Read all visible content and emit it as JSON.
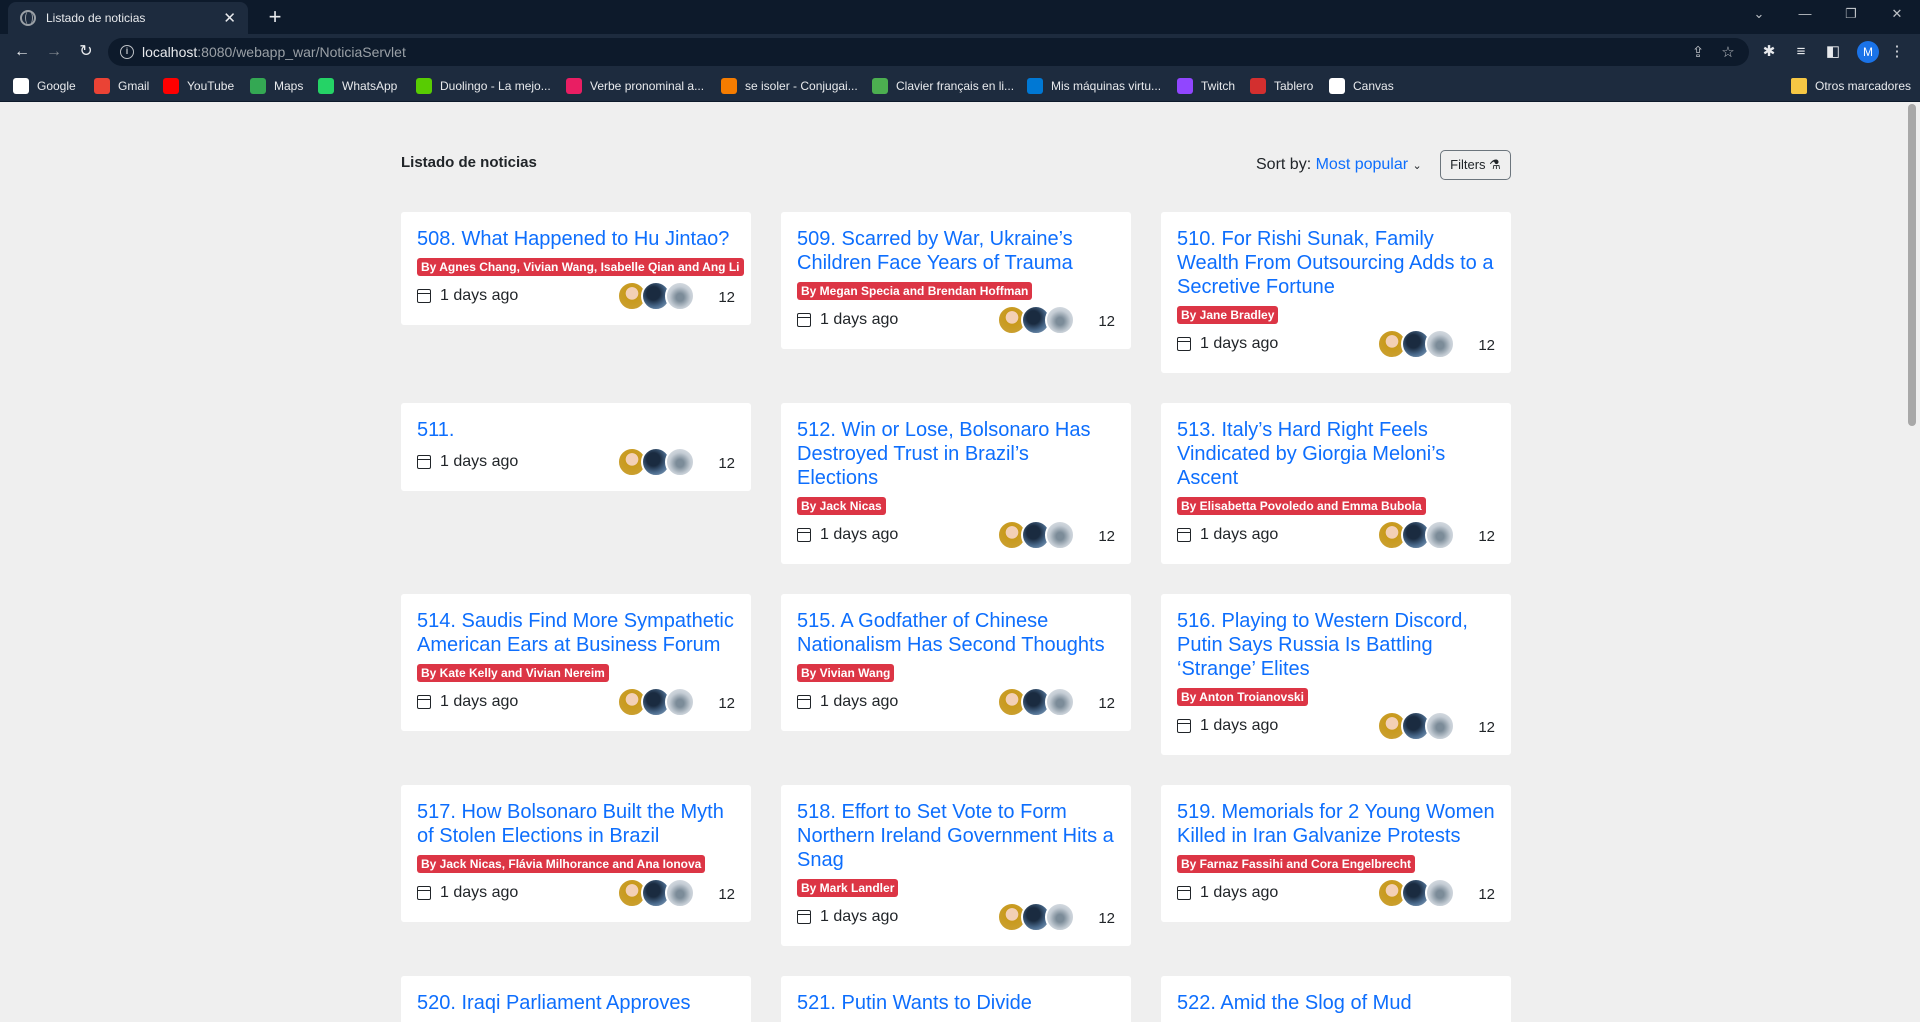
{
  "browser": {
    "tab_title": "Listado de noticias",
    "url_host": "localhost",
    "url_path": ":8080/webapp_war/NoticiaServlet",
    "profile_initial": "M"
  },
  "bookmarks": [
    {
      "label": "Google",
      "icon": "google-icon",
      "color": "#ffffff"
    },
    {
      "label": "Gmail",
      "icon": "gmail-icon",
      "color": "#ea4335"
    },
    {
      "label": "YouTube",
      "icon": "youtube-icon",
      "color": "#ff0000"
    },
    {
      "label": "Maps",
      "icon": "maps-icon",
      "color": "#34a853"
    },
    {
      "label": "WhatsApp",
      "icon": "whatsapp-icon",
      "color": "#25d366"
    },
    {
      "label": "Duolingo - La mejo...",
      "icon": "duolingo-icon",
      "color": "#58cc02"
    },
    {
      "label": "Verbe pronominal a...",
      "icon": "verbe-icon",
      "color": "#e91e63"
    },
    {
      "label": "se isoler - Conjugai...",
      "icon": "conjugaison-icon",
      "color": "#f57c00"
    },
    {
      "label": "Clavier français en li...",
      "icon": "clavier-icon",
      "color": "#4caf50"
    },
    {
      "label": "Mis máquinas virtu...",
      "icon": "azure-icon",
      "color": "#0078d4"
    },
    {
      "label": "Twitch",
      "icon": "twitch-icon",
      "color": "#9146ff"
    },
    {
      "label": "Tablero",
      "icon": "tablero-icon",
      "color": "#d32f2f"
    },
    {
      "label": "Canvas",
      "icon": "canvas-icon",
      "color": "#ffffff"
    }
  ],
  "other_bookmarks": "Otros marcadores",
  "page": {
    "title": "Listado de noticias",
    "sort_label": "Sort by:",
    "sort_value": "Most popular",
    "filters_label": "Filters"
  },
  "date_text": "1 days ago",
  "count_text": "12",
  "articles": [
    {
      "title": "508. What Happened to Hu Jintao?",
      "byline": "By Agnes Chang, Vivian Wang, Isabelle Qian and Ang Li"
    },
    {
      "title": "509. Scarred by War, Ukraine’s Children Face Years of Trauma",
      "byline": "By Megan Specia and Brendan Hoffman"
    },
    {
      "title": "510. For Rishi Sunak, Family Wealth From Outsourcing Adds to a Secretive Fortune",
      "byline": "By Jane Bradley"
    },
    {
      "title": "511.",
      "byline": ""
    },
    {
      "title": "512. Win or Lose, Bolsonaro Has Destroyed Trust in Brazil’s Elections",
      "byline": "By Jack Nicas"
    },
    {
      "title": "513. Italy’s Hard Right Feels Vindicated by Giorgia Meloni’s Ascent",
      "byline": "By Elisabetta Povoledo and Emma Bubola"
    },
    {
      "title": "514. Saudis Find More Sympathetic American Ears at Business Forum",
      "byline": "By Kate Kelly and Vivian Nereim"
    },
    {
      "title": "515. A Godfather of Chinese Nationalism Has Second Thoughts",
      "byline": "By Vivian Wang"
    },
    {
      "title": "516. Playing to Western Discord, Putin Says Russia Is Battling ‘Strange’ Elites",
      "byline": "By Anton Troianovski"
    },
    {
      "title": "517. How Bolsonaro Built the Myth of Stolen Elections in Brazil",
      "byline": "By Jack Nicas, Flávia Milhorance and Ana Ionova"
    },
    {
      "title": "518. Effort to Set Vote to Form Northern Ireland Government Hits a Snag",
      "byline": "By Mark Landler"
    },
    {
      "title": "519. Memorials for 2 Young Women Killed in Iran Galvanize Protests",
      "byline": "By Farnaz Fassihi and Cora Engelbrecht"
    },
    {
      "title": "520. Iraqi Parliament Approves",
      "byline": ""
    },
    {
      "title": "521. Putin Wants to Divide",
      "byline": ""
    },
    {
      "title": "522. Amid the Slog of Mud",
      "byline": ""
    }
  ]
}
